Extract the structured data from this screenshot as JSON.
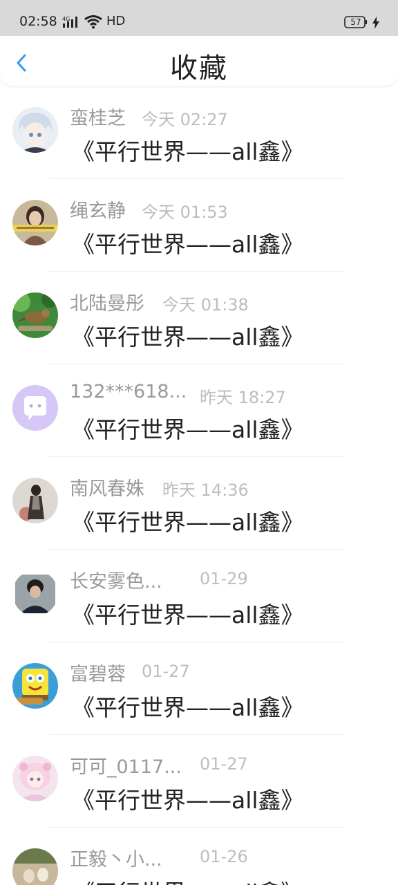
{
  "status_bar": {
    "time": "02:58",
    "network": "4G",
    "hd": "HD",
    "battery": "57"
  },
  "header": {
    "title": "收藏",
    "back_icon": "chevron-left-icon"
  },
  "colors": {
    "accent": "#2e9df7",
    "name_gray": "#999999",
    "time_gray": "#bdbdbd",
    "title_text": "#222222"
  },
  "items": [
    {
      "name": "蛮桂芝",
      "time": "今天 02:27",
      "title": "《平行世界——all鑫》",
      "avatar": "anime-avatar"
    },
    {
      "name": "绳玄静",
      "time": "今天 01:53",
      "title": "《平行世界——all鑫》",
      "avatar": "photo-avatar"
    },
    {
      "name": "北陆曼彤",
      "time": "今天 01:38",
      "title": "《平行世界——all鑫》",
      "avatar": "bird-avatar"
    },
    {
      "name": "132***618...",
      "time": "昨天 18:27",
      "title": "《平行世界——all鑫》",
      "avatar": "chat-bubble-avatar"
    },
    {
      "name": "南风春姝",
      "time": "昨天 14:36",
      "title": "《平行世界——all鑫》",
      "avatar": "portrait-avatar"
    },
    {
      "name": "长安雾色...",
      "time": "01-29",
      "title": "《平行世界——all鑫》",
      "avatar": "photo-avatar"
    },
    {
      "name": "富碧蓉",
      "time": "01-27",
      "title": "《平行世界——all鑫》",
      "avatar": "cartoon-avatar"
    },
    {
      "name": "可可_0117...",
      "time": "01-27",
      "title": "《平行世界——all鑫》",
      "avatar": "anime-avatar"
    },
    {
      "name": "正毅丶小...",
      "time": "01-26",
      "title": "《平行世界——all鑫》",
      "avatar": "photo-avatar"
    }
  ]
}
